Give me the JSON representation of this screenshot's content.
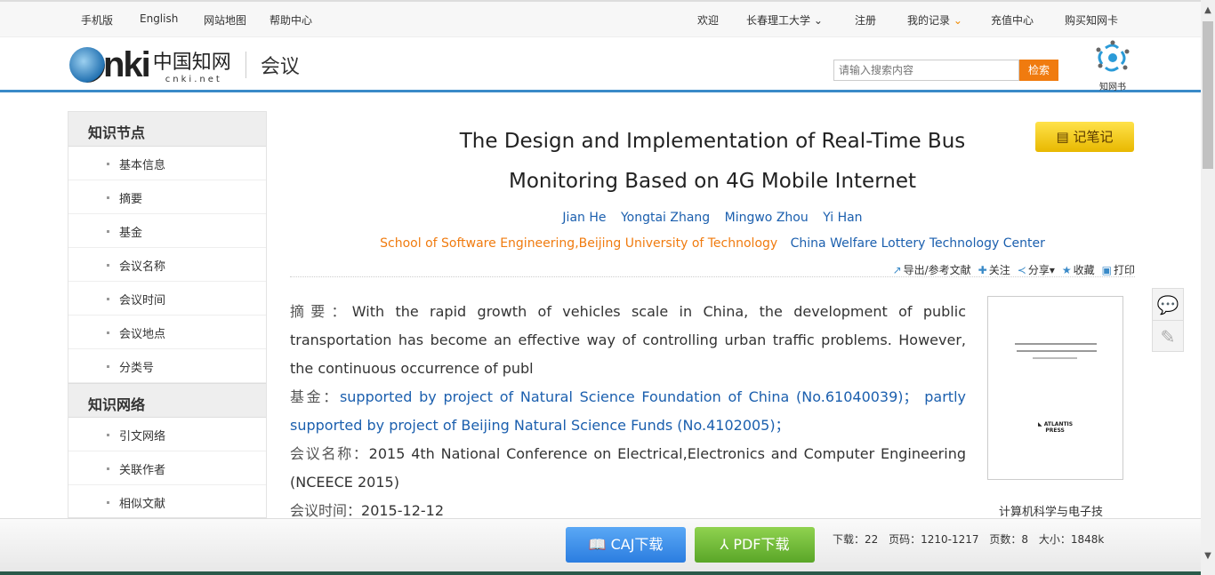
{
  "topbar": {
    "left": [
      "手机版",
      "English",
      "网站地图",
      "帮助中心"
    ],
    "welcome": "欢迎",
    "institution": "长春理工大学",
    "register": "注册",
    "records": "我的记录",
    "recharge": "充值中心",
    "buy_card": "购买知网卡"
  },
  "header": {
    "logo_text": "CNKI中国知网 cnki.net",
    "logo_cn": "中国知网",
    "logo_en": "cnki.net",
    "section": "会议",
    "search_placeholder": "请输入搜索内容",
    "search_button": "检索",
    "zhiwangshu": "知网书"
  },
  "sidebar": {
    "sections": [
      {
        "title": "知识节点",
        "items": [
          "基本信息",
          "摘要",
          "基金",
          "会议名称",
          "会议时间",
          "会议地点",
          "分类号"
        ]
      },
      {
        "title": "知识网络",
        "items": [
          "引文网络",
          "关联作者",
          "相似文献"
        ]
      }
    ]
  },
  "article": {
    "title_line1": "The Design and Implementation of Real-Time Bus",
    "title_line2": "Monitoring Based on 4G Mobile Internet",
    "note_button": "记笔记",
    "authors": [
      "Jian He",
      "Yongtai Zhang",
      "Mingwo Zhou",
      "Yi Han"
    ],
    "orgs": [
      "School of Software Engineering,Beijing University of Technology",
      "China Welfare Lottery Technology Center"
    ],
    "tools": [
      "导出/参考文献",
      "关注",
      "分享",
      "收藏",
      "打印"
    ],
    "abstract_label": "摘要：",
    "abstract": "With the rapid growth of vehicles scale in China, the development of public transportation has become an effective way of controlling urban traffic problems. However, the continuous occurrence of publ",
    "fund_label": "基金：",
    "fund": "supported by project of Natural Science Foundation of China (No.61040039)； partly supported by project of Beijing Natural Science Funds (No.4102005)；",
    "conf_label": "会议名称：",
    "conf": "2015 4th National Conference on Electrical,Electronics and Computer Engineering (NCEECE 2015)",
    "time_label": "会议时间：",
    "time": "2015-12-12",
    "category": "计算机科学与电子技",
    "thumb_publisher": "ATLANTIS PRESS"
  },
  "bottom": {
    "caj": "CAJ下载",
    "pdf": "PDF下载",
    "downloads": "下载：22",
    "pages_range": "页码：1210-1217",
    "page_count": "页数：8",
    "size": "大小：1848k"
  },
  "colors": {
    "accent_blue": "#3a8ac8",
    "orange": "#f07b0f",
    "link": "#1b5fae"
  }
}
